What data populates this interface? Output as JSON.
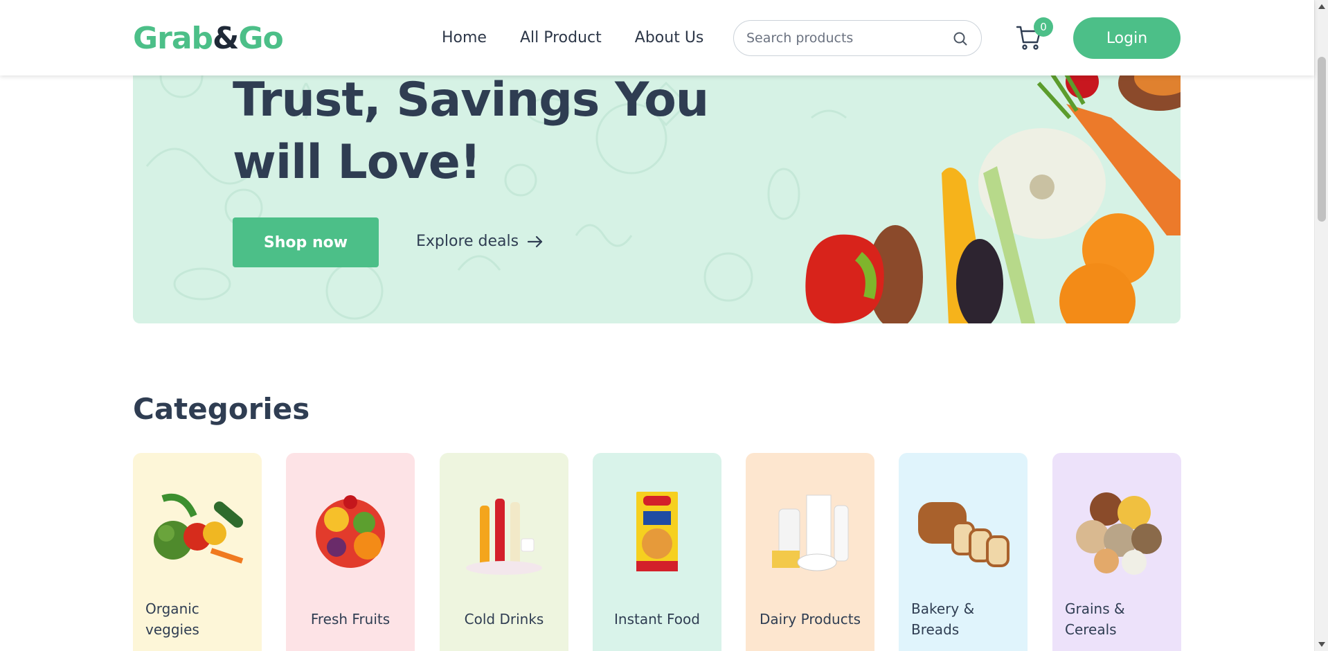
{
  "header": {
    "logo_part1": "Grab",
    "logo_amp": "&",
    "logo_part2": "Go",
    "nav": [
      "Home",
      "All Product",
      "About Us"
    ],
    "search_placeholder": "Search products",
    "cart_count": "0",
    "login_label": "Login"
  },
  "hero": {
    "title_line1": "Trust, Savings You",
    "title_line2": "will Love!",
    "shop_button": "Shop now",
    "explore_link": "Explore deals",
    "background_color": "#d6f2e5"
  },
  "categories": {
    "title": "Categories",
    "items": [
      {
        "label": "Organic veggies",
        "color": "#fdf6d8",
        "icon": "vegetables-image"
      },
      {
        "label": "Fresh Fruits",
        "color": "#fde3e6",
        "icon": "fruits-image"
      },
      {
        "label": "Cold Drinks",
        "color": "#eef5df",
        "icon": "cold-drinks-image"
      },
      {
        "label": "Instant Food",
        "color": "#d9f3ea",
        "icon": "instant-food-image"
      },
      {
        "label": "Dairy Products",
        "color": "#fde6cf",
        "icon": "dairy-image"
      },
      {
        "label": "Bakery & Breads",
        "color": "#e0f4fc",
        "icon": "bread-image"
      },
      {
        "label": "Grains & Cereals",
        "color": "#ede2fa",
        "icon": "grains-image"
      }
    ]
  },
  "colors": {
    "accent": "#4cbf88",
    "text_dark": "#2f3d52"
  }
}
